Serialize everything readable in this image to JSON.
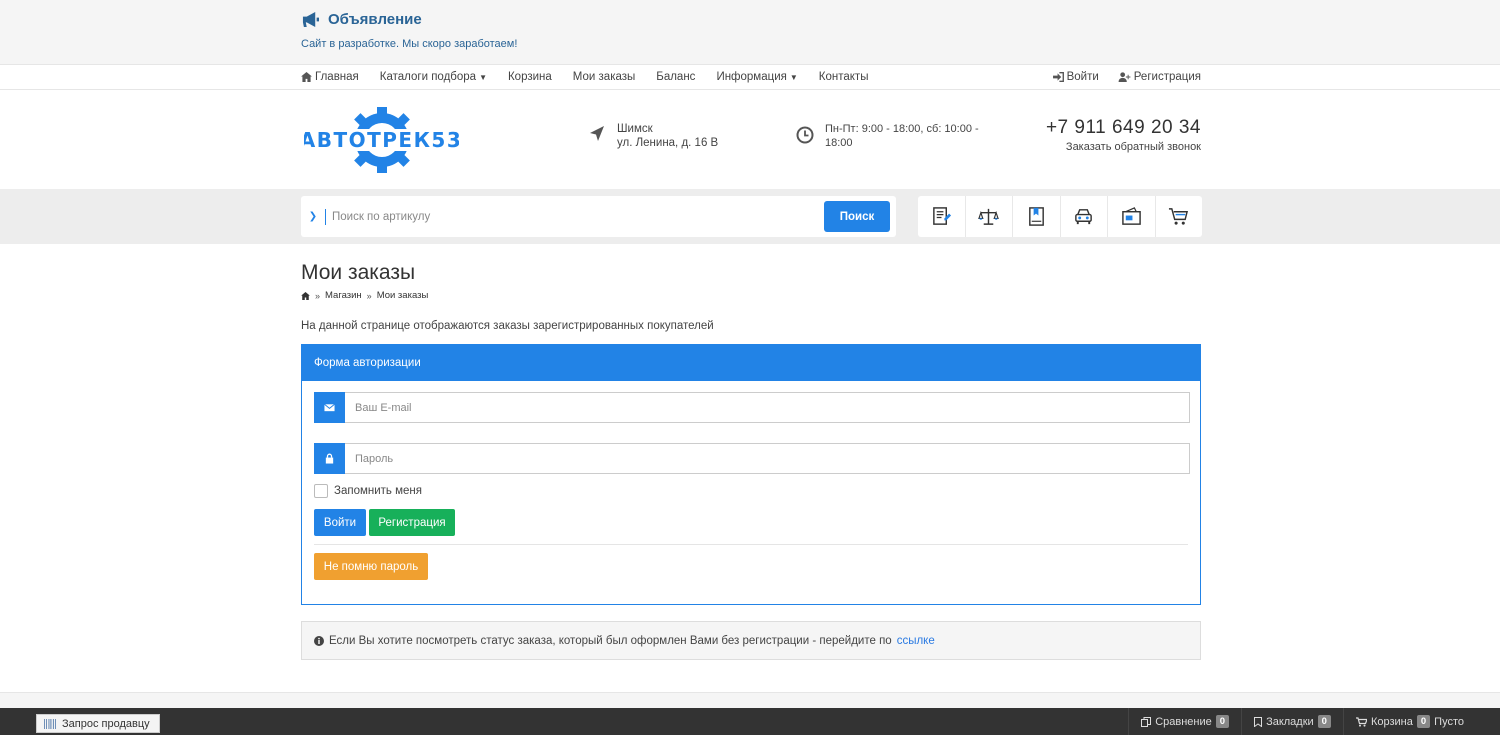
{
  "announcement": {
    "title": "Объявление",
    "text": "Сайт в разработке. Мы скоро заработаем!"
  },
  "topnav": {
    "items": [
      {
        "label": "Главная"
      },
      {
        "label": "Каталоги подбора"
      },
      {
        "label": "Корзина"
      },
      {
        "label": "Мои заказы"
      },
      {
        "label": "Баланс"
      },
      {
        "label": "Информация"
      },
      {
        "label": "Контакты"
      }
    ],
    "login": "Войти",
    "register": "Регистрация"
  },
  "header": {
    "logo_text": "АВТОТРЕК53",
    "city": "Шимск",
    "street": "ул. Ленина, д. 16 В",
    "hours": "Пн-Пт: 9:00 - 18:00, сб: 10:00 - 18:00",
    "phone": "+7 911 649 20 34",
    "callback": "Заказать обратный звонок"
  },
  "search": {
    "placeholder": "Поиск по артикулу",
    "button": "Поиск"
  },
  "tools": [
    "catalog-icon",
    "compare-scales-icon",
    "bookmark-book-icon",
    "car-icon",
    "wallet-icon",
    "cart-icon"
  ],
  "page": {
    "title": "Мои заказы",
    "breadcrumb": [
      "Магазин",
      "Мои заказы"
    ],
    "intro": "На данной странице отображаются заказы зарегистрированных покупателей"
  },
  "auth": {
    "heading": "Форма авторизации",
    "email_placeholder": "Ваш E-mail",
    "password_placeholder": "Пароль",
    "remember": "Запомнить меня",
    "login_btn": "Войти",
    "register_btn": "Регистрация",
    "forgot_btn": "Не помню пароль"
  },
  "notice": {
    "text": "Если Вы хотите посмотреть статус заказа, который был оформлен Вами без регистрации - перейдите по",
    "link": "ссылке"
  },
  "bottombar": {
    "seller": "Запрос продавцу",
    "compare": "Сравнение",
    "compare_count": "0",
    "bookmarks": "Закладки",
    "bookmarks_count": "0",
    "cart": "Корзина",
    "cart_count": "0",
    "cart_status": "Пусто"
  },
  "colors": {
    "accent": "#2283e6",
    "success": "#17b05a",
    "warning": "#f0a030",
    "link": "#2a6496"
  }
}
